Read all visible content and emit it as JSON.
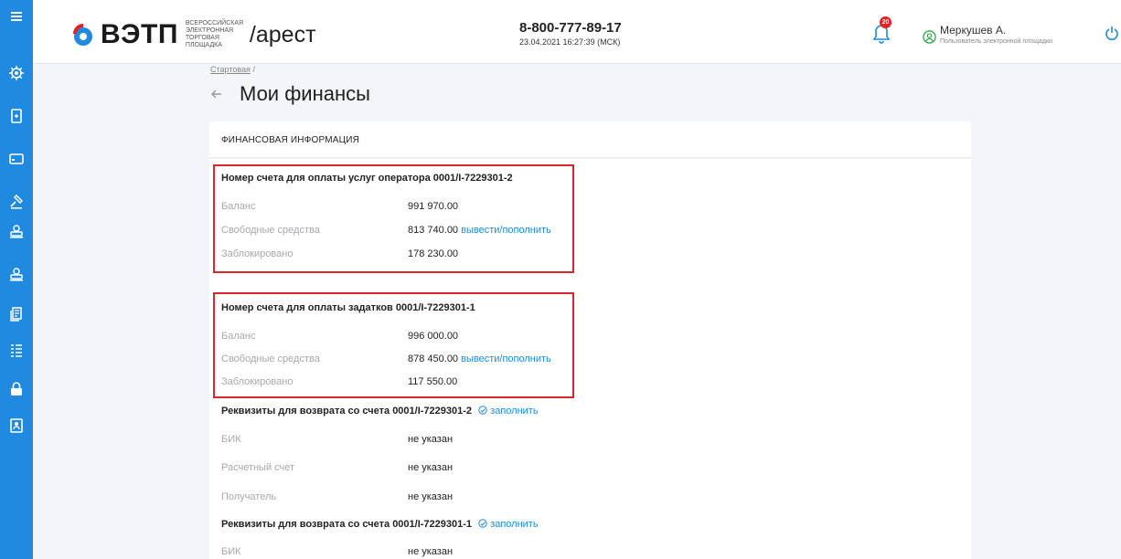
{
  "colors": {
    "accent": "#1f8ae0",
    "highlight_box": "#d8262e",
    "badge": "#e52222",
    "muted_label": "#a5a8ad"
  },
  "sidebar": {
    "items": [
      {
        "icon": "menu-icon"
      },
      {
        "icon": "gear-icon"
      },
      {
        "icon": "document-icon"
      },
      {
        "icon": "wallet-icon"
      },
      {
        "icon": "gavel-icon"
      },
      {
        "icon": "stamp-icon"
      },
      {
        "icon": "stamp-icon"
      },
      {
        "icon": "file-list-icon"
      },
      {
        "icon": "list-icon"
      },
      {
        "icon": "lock-icon"
      },
      {
        "icon": "contacts-icon"
      }
    ]
  },
  "header": {
    "logo_text": "ВЭТП",
    "logo_subtitle": "ВСЕРОССИЙСКАЯ ЭЛЕКТРОННАЯ ТОРГОВАЯ ПЛОЩАДКА",
    "section": "/арест",
    "phone": "8-800-777-89-17",
    "datetime": "23.04.2021 16:27:39 (МСК)",
    "notifications_count": "20",
    "user_name": "Меркушев А.",
    "user_role": "Пользователь электронной площадки"
  },
  "breadcrumb": {
    "home": "Стартовая",
    "separator": "/"
  },
  "page_title": "Мои финансы",
  "card_title": "ФИНАНСОВАЯ ИНФОРМАЦИЯ",
  "accounts": [
    {
      "title": "Номер счета для оплаты услуг оператора 0001/I-7229301-2",
      "balance_label": "Баланс",
      "balance": "991 970.00",
      "free_label": "Свободные средства",
      "free": "813 740.00",
      "free_action": "вывести/пополнить",
      "blocked_label": "Заблокировано",
      "blocked": "178 230.00"
    },
    {
      "title": "Номер счета для оплаты задатков 0001/I-7229301-1",
      "balance_label": "Баланс",
      "balance": "996 000.00",
      "free_label": "Свободные средства",
      "free": "878 450.00",
      "free_action": "вывести/пополнить",
      "blocked_label": "Заблокировано",
      "blocked": "117 550.00"
    }
  ],
  "refunds": [
    {
      "title": "Реквизиты для возврата со счета 0001/I-7229301-2",
      "action": "заполнить",
      "rows": [
        {
          "label": "БИК",
          "value": "не указан"
        },
        {
          "label": "Расчетный счет",
          "value": "не указан"
        },
        {
          "label": "Получатель",
          "value": "не указан"
        }
      ]
    },
    {
      "title": "Реквизиты для возврата со счета 0001/I-7229301-1",
      "action": "заполнить",
      "rows": [
        {
          "label": "БИК",
          "value": "не указан"
        }
      ]
    }
  ]
}
